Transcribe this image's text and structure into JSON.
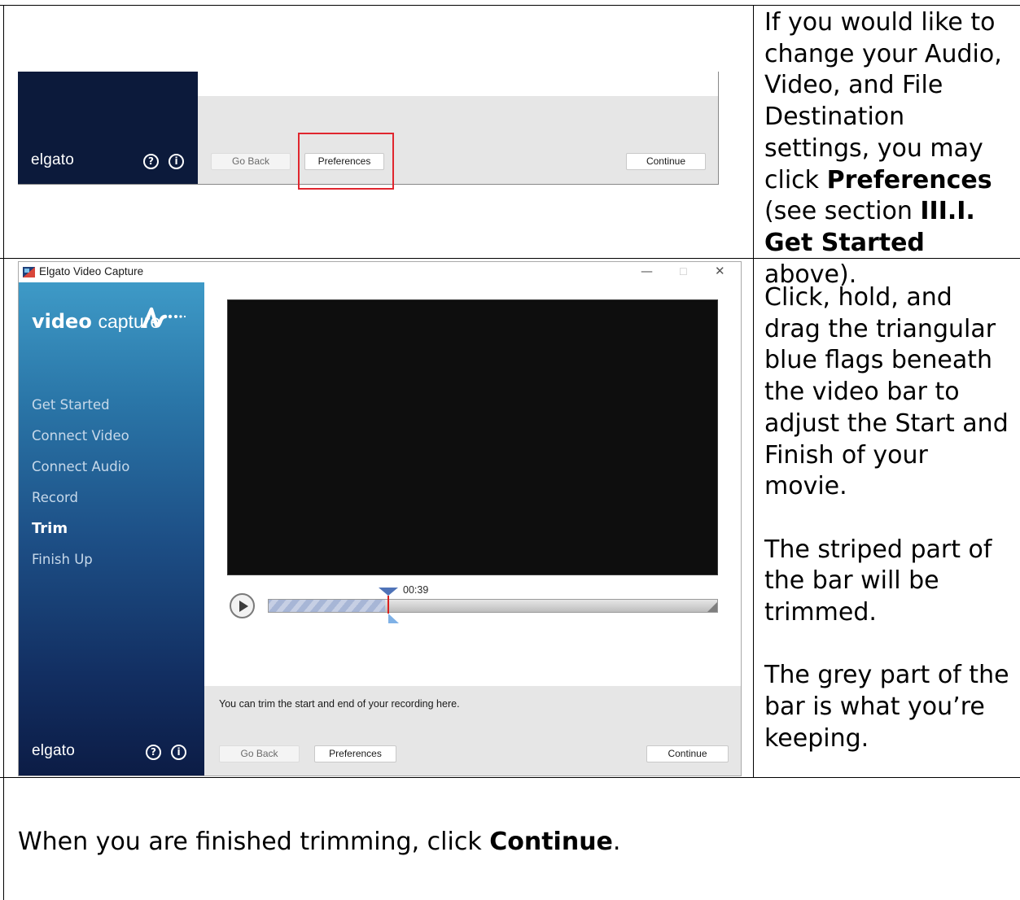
{
  "row1": {
    "screenshot": {
      "logo": "elgato",
      "help_icon": "question-circle-icon",
      "info_icon": "info-circle-icon",
      "go_back": "Go Back",
      "preferences": "Preferences",
      "continue": "Continue"
    },
    "text": {
      "part1": "If you would like to change your Audio, Video, and File Destination settings, you may click ",
      "bold1": "Preferences",
      "part2": " (see section ",
      "bold2": "III.I. Get Started",
      "part3": " above)."
    }
  },
  "row2": {
    "window": {
      "title": "Elgato Video Capture",
      "minimize": "—",
      "maximize": "☐",
      "close": "✕",
      "brand_bold": "video",
      "brand_light": "capture",
      "nav": [
        "Get Started",
        "Connect Video",
        "Connect Audio",
        "Record",
        "Trim",
        "Finish Up"
      ],
      "active_nav": "Trim",
      "timecode": "00:39",
      "trim_fraction": 0.26,
      "hint": "You can trim the start and end of your recording here.",
      "logo": "elgato",
      "go_back": "Go Back",
      "preferences": "Preferences",
      "continue": "Continue"
    },
    "text": {
      "para1": "Click, hold, and drag the triangular blue flags beneath the video bar to adjust the Start and Finish of your movie.",
      "para2": "The striped part of the bar will be trimmed.",
      "para3": "The grey part of the bar is what you’re keeping."
    }
  },
  "row3": {
    "text": {
      "part1": "When you are finished trimming, click ",
      "bold": "Continue",
      "part2": "."
    }
  },
  "colors": {
    "highlight_border": "#e0262e",
    "sidebar_top": "#3e9ac7",
    "sidebar_bottom": "#0c1c45",
    "playhead_flag": "#4f73b8",
    "trim_flag": "#7fb1e6"
  }
}
